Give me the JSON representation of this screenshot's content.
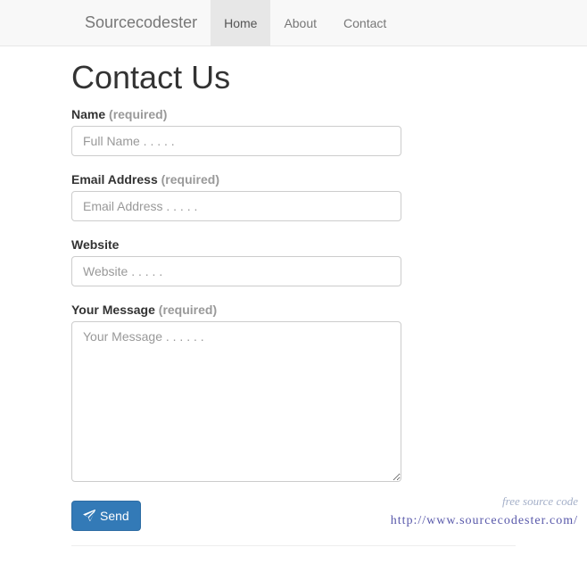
{
  "navbar": {
    "brand": "Sourcecodester",
    "items": [
      {
        "label": "Home",
        "active": true
      },
      {
        "label": "About",
        "active": false
      },
      {
        "label": "Contact",
        "active": false
      }
    ]
  },
  "page": {
    "title": "Contact Us"
  },
  "form": {
    "name": {
      "label": "Name",
      "hint": "(required)",
      "placeholder": "Full Name . . . . ."
    },
    "email": {
      "label": "Email Address",
      "hint": "(required)",
      "placeholder": "Email Address . . . . ."
    },
    "website": {
      "label": "Website",
      "placeholder": "Website . . . . ."
    },
    "message": {
      "label": "Your Message",
      "hint": "(required)",
      "placeholder": "Your Message . . . . . ."
    },
    "submit": {
      "label": " Send"
    }
  },
  "watermark": {
    "tagline": "free source code",
    "url": "http://www.sourcecodester.com/"
  }
}
